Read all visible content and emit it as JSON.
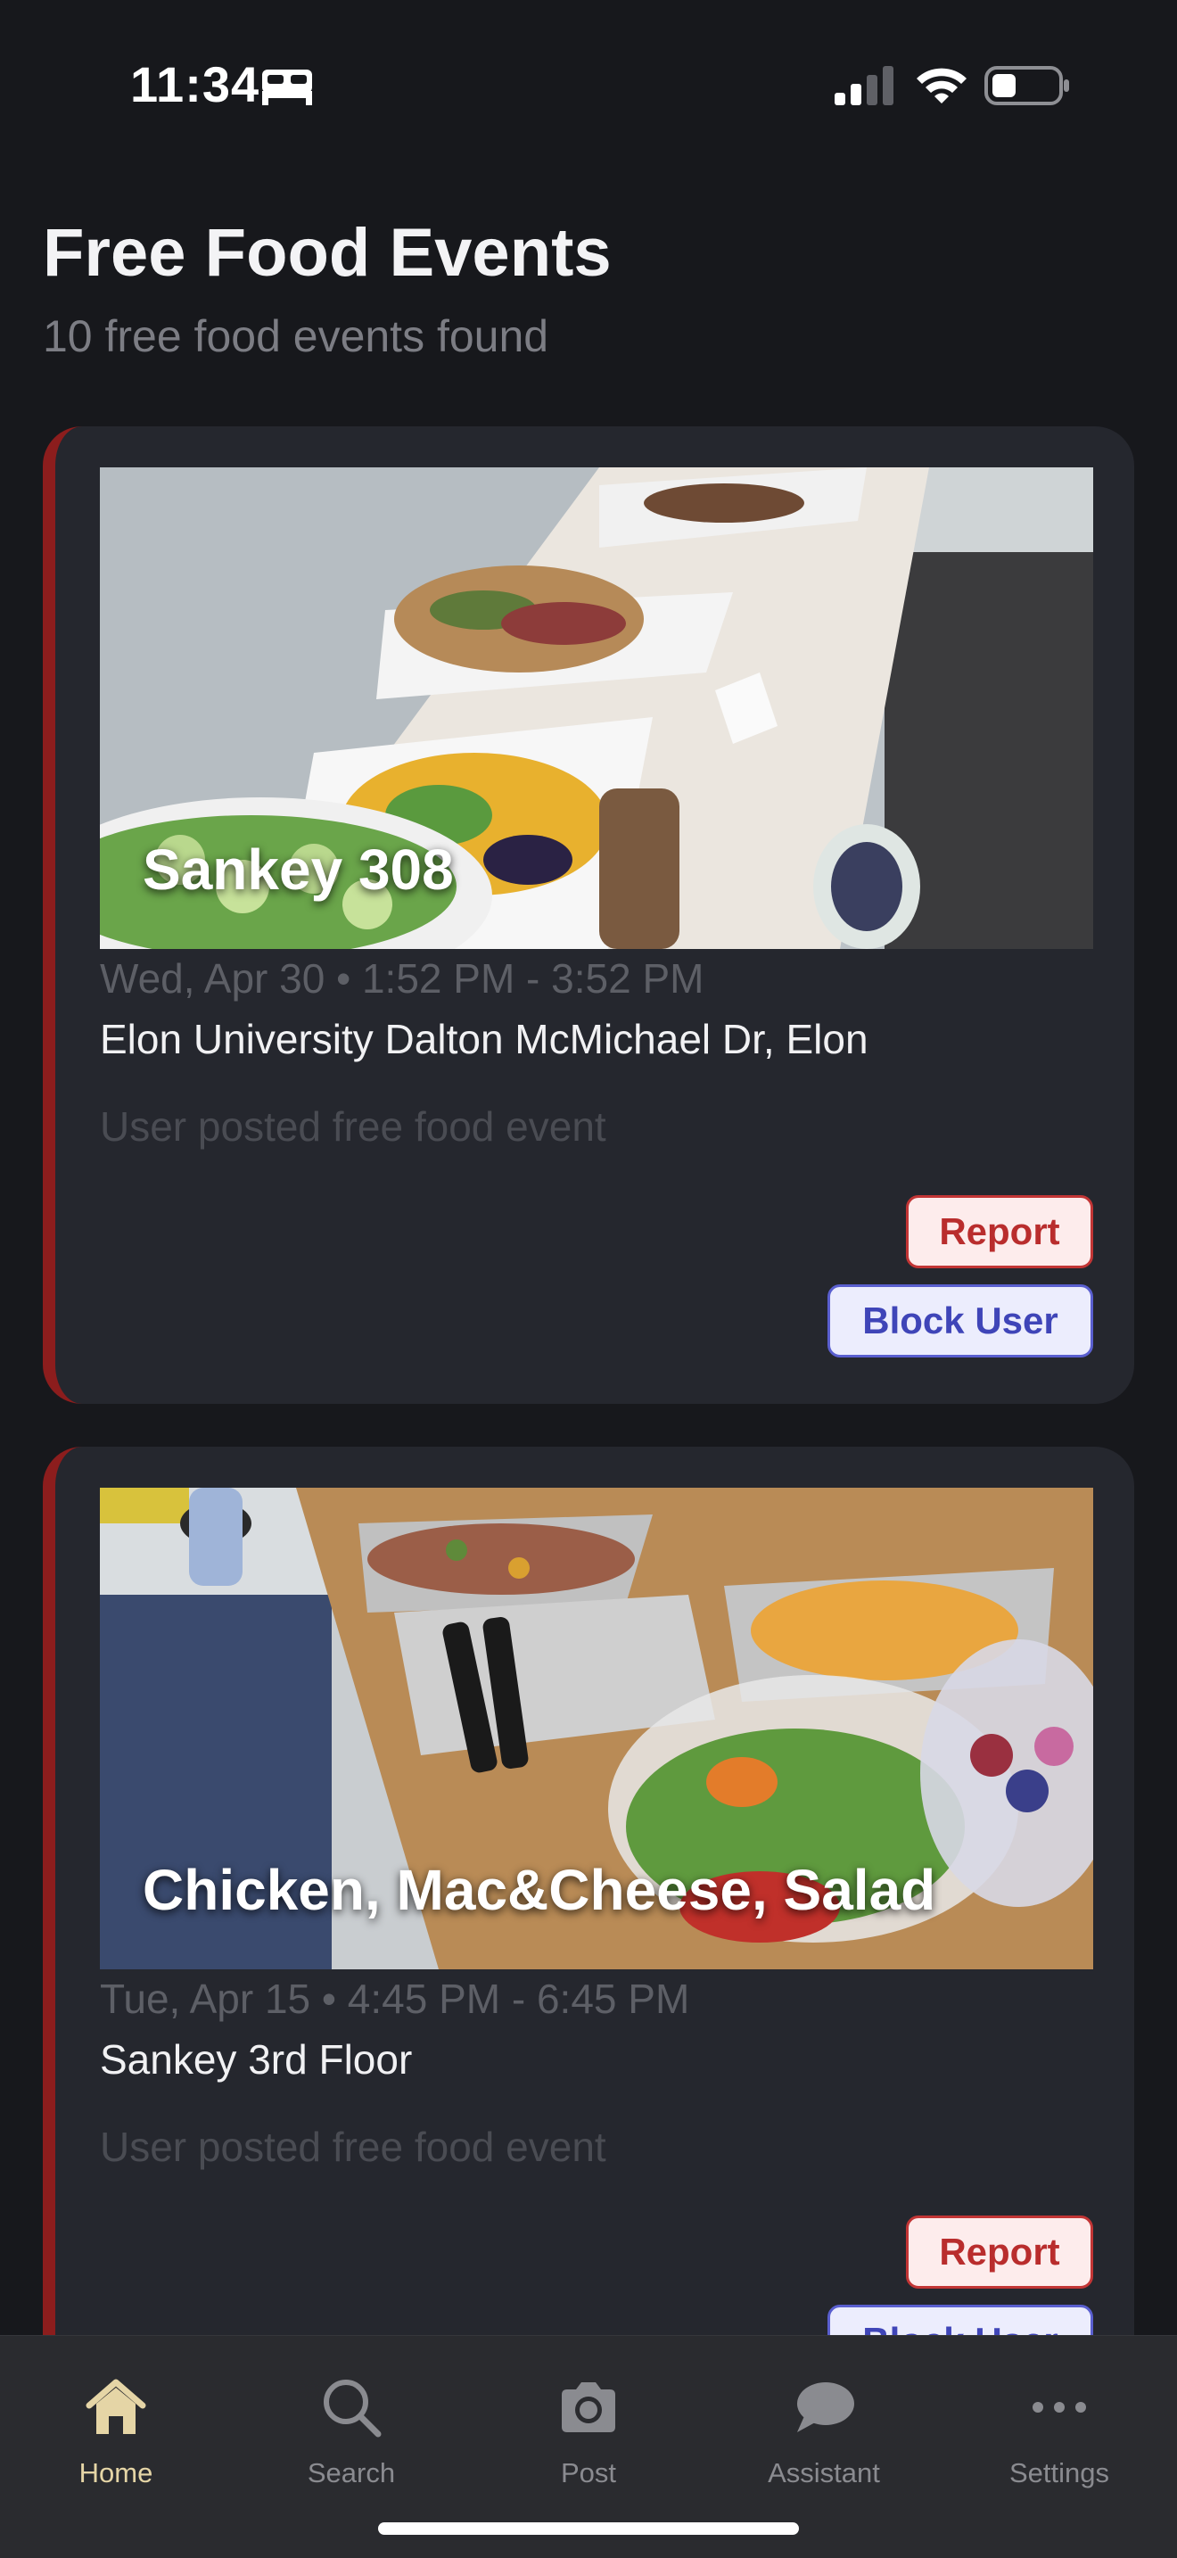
{
  "status_bar": {
    "time": "11:34",
    "icons": [
      "bed-icon",
      "signal-icon",
      "wifi-icon",
      "battery-icon"
    ]
  },
  "header": {
    "title": "Free Food Events",
    "subtitle": "10 free food events found"
  },
  "events": [
    {
      "title": "Sankey 308",
      "time": "Wed, Apr 30 • 1:52 PM - 3:52 PM",
      "location": "Elon University Dalton McMichael Dr, Elon",
      "description": "User posted free food event",
      "report_label": "Report",
      "block_label": "Block User"
    },
    {
      "title": "Chicken, Mac&Cheese, Salad",
      "time": "Tue, Apr 15 • 4:45 PM - 6:45 PM",
      "location": "Sankey 3rd Floor",
      "description": "User posted free food event",
      "report_label": "Report",
      "block_label": "Block User"
    }
  ],
  "tab_bar": {
    "tabs": [
      {
        "label": "Home",
        "icon": "house-icon",
        "active": true
      },
      {
        "label": "Search",
        "icon": "magnifier-icon",
        "active": false
      },
      {
        "label": "Post",
        "icon": "camera-icon",
        "active": false
      },
      {
        "label": "Assistant",
        "icon": "chat-bubble-icon",
        "active": false
      },
      {
        "label": "Settings",
        "icon": "ellipsis-icon",
        "active": false
      }
    ]
  },
  "colors": {
    "background": "#17181c",
    "card": "#25272e",
    "card_accent": "#8c1d1d",
    "report": "#b92d2d",
    "block": "#3f45b8",
    "active_tab": "#e5d5a6"
  }
}
